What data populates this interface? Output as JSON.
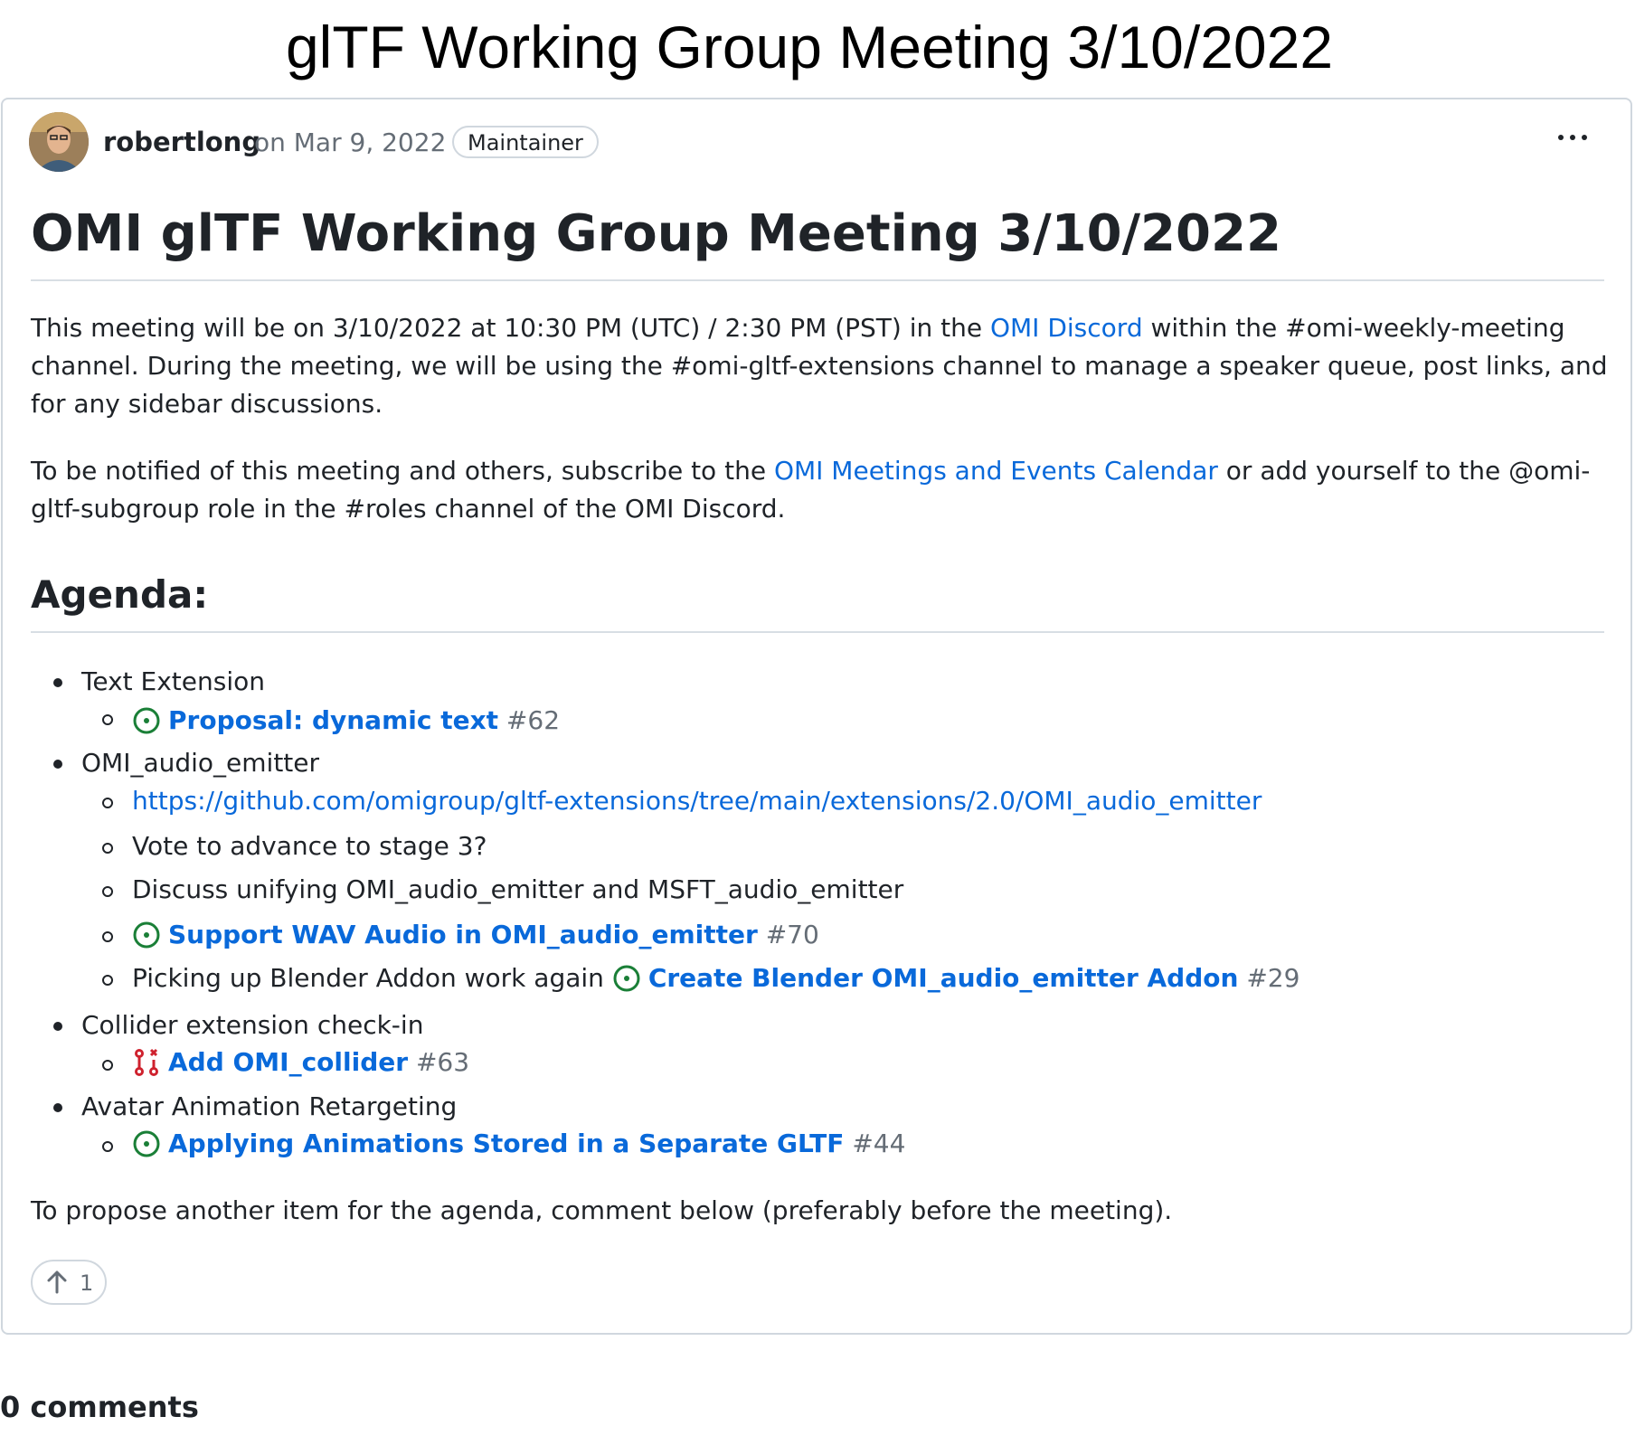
{
  "page": {
    "title": "glTF Working Group Meeting 3/10/2022"
  },
  "post": {
    "author": "robertlong",
    "date": "on Mar 9, 2022",
    "role_badge": "Maintainer",
    "title": "OMI glTF Working Group Meeting 3/10/2022",
    "intro": {
      "p1_before": "This meeting will be on 3/10/2022 at 10:30 PM (UTC) / 2:30 PM (PST) in the ",
      "p1_link": "OMI Discord",
      "p1_after": " within the #omi-weekly-meeting channel. During the meeting, we will be using the #omi-gltf-extensions channel to manage a speaker queue, post links, and for any sidebar discussions.",
      "p2_before": "To be notified of this meeting and others, subscribe to the ",
      "p2_link": "OMI Meetings and Events Calendar",
      "p2_after": " or add yourself to the @omi-gltf-subgroup role in the #roles channel of the OMI Discord."
    },
    "agenda_heading": "Agenda:",
    "agenda": {
      "text_extension": {
        "label": "Text Extension",
        "issue_title": "Proposal: dynamic text",
        "issue_number": "#62"
      },
      "audio_emitter": {
        "label": "OMI_audio_emitter",
        "url": "https://github.com/omigroup/gltf-extensions/tree/main/extensions/2.0/OMI_audio_emitter",
        "vote": "Vote to advance to stage 3?",
        "discuss": "Discuss unifying OMI_audio_emitter and MSFT_audio_emitter",
        "wav_title": "Support WAV Audio in OMI_audio_emitter",
        "wav_number": "#70",
        "blender_prefix": "Picking up Blender Addon work again ",
        "blender_title": "Create Blender OMI_audio_emitter Addon",
        "blender_number": "#29"
      },
      "collider": {
        "label": "Collider extension check-in",
        "pr_title": "Add OMI_collider",
        "pr_number": "#63"
      },
      "avatar": {
        "label": "Avatar Animation Retargeting",
        "issue_title": "Applying Animations Stored in a Separate GLTF",
        "issue_number": "#44"
      }
    },
    "closing": "To propose another item for the agenda, comment below (preferably before the meeting).",
    "upvote_count": "1"
  },
  "comments": {
    "count_label": "0 comments"
  },
  "colors": {
    "link": "#0969da",
    "open_issue": "#1a7f37",
    "closed_pr": "#cf222e",
    "border": "#d0d7de",
    "muted": "#656d76"
  },
  "icons": [
    "avatar",
    "kebab-menu-icon",
    "issue-open-icon",
    "pr-closed-icon",
    "arrow-up-icon"
  ]
}
